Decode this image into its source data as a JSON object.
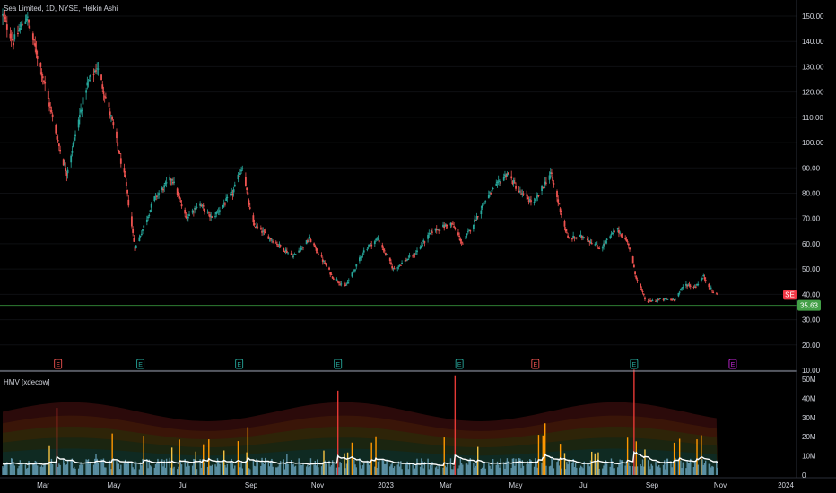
{
  "header": {
    "title": "Sea Limited, 1D, NYSE, Heikin Ashi",
    "symbol_badge": "SE",
    "price_badge": "35.63",
    "volume_indicator_label": "HMV [xdecow]"
  },
  "colors": {
    "up": "#26a69a",
    "down": "#ef5350",
    "price_line": "#2e7d32",
    "price_badge_bg": "#43a047",
    "symbol_badge_bg": "#f23645",
    "earn_past": "#ef5350",
    "earn_up": "#26a69a",
    "earn_future": "#c026d3",
    "vol_ma": "#ffffff"
  },
  "chart_data": [
    {
      "type": "candlestick",
      "title": "Sea Limited, 1D, NYSE, Heikin Ashi",
      "y_ticks": [
        "150.00",
        "140.00",
        "130.00",
        "120.00",
        "110.00",
        "100.00",
        "90.00",
        "80.00",
        "70.00",
        "60.00",
        "50.00",
        "40.00",
        "30.00",
        "20.00",
        "10.00"
      ],
      "ylim": [
        10,
        150
      ],
      "x_ticks": [
        "Mar",
        "May",
        "Jul",
        "Sep",
        "Nov",
        "2023",
        "Mar",
        "May",
        "Jul",
        "Sep",
        "Nov",
        "2024"
      ],
      "current_price": 35.63,
      "last_close": 40,
      "price_path": [
        [
          "2022-01-10",
          150
        ],
        [
          "2022-01-20",
          140
        ],
        [
          "2022-02-01",
          150
        ],
        [
          "2022-02-15",
          128
        ],
        [
          "2022-03-05",
          95
        ],
        [
          "2022-03-10",
          88
        ],
        [
          "2022-03-28",
          122
        ],
        [
          "2022-04-07",
          130
        ],
        [
          "2022-04-20",
          110
        ],
        [
          "2022-05-03",
          85
        ],
        [
          "2022-05-12",
          58
        ],
        [
          "2022-05-30",
          78
        ],
        [
          "2022-06-15",
          86
        ],
        [
          "2022-06-28",
          70
        ],
        [
          "2022-07-10",
          76
        ],
        [
          "2022-07-22",
          70
        ],
        [
          "2022-08-10",
          80
        ],
        [
          "2022-08-19",
          91
        ],
        [
          "2022-08-28",
          68
        ],
        [
          "2022-09-20",
          60
        ],
        [
          "2022-10-05",
          55
        ],
        [
          "2022-10-20",
          62
        ],
        [
          "2022-11-10",
          47
        ],
        [
          "2022-11-22",
          43
        ],
        [
          "2022-12-10",
          58
        ],
        [
          "2022-12-22",
          62
        ],
        [
          "2023-01-05",
          50
        ],
        [
          "2023-01-25",
          56
        ],
        [
          "2023-02-10",
          65
        ],
        [
          "2023-02-28",
          68
        ],
        [
          "2023-03-10",
          60
        ],
        [
          "2023-04-01",
          78
        ],
        [
          "2023-04-20",
          88
        ],
        [
          "2023-05-02",
          80
        ],
        [
          "2023-05-15",
          76
        ],
        [
          "2023-05-30",
          88
        ],
        [
          "2023-06-15",
          62
        ],
        [
          "2023-06-30",
          63
        ],
        [
          "2023-07-15",
          58
        ],
        [
          "2023-07-30",
          66
        ],
        [
          "2023-08-10",
          60
        ],
        [
          "2023-08-16",
          48
        ],
        [
          "2023-08-26",
          37
        ],
        [
          "2023-09-10",
          38
        ],
        [
          "2023-09-21",
          38
        ],
        [
          "2023-10-01",
          44
        ],
        [
          "2023-10-10",
          43
        ],
        [
          "2023-10-18",
          47
        ],
        [
          "2023-10-28",
          40
        ]
      ]
    },
    {
      "type": "bar",
      "title": "HMV [xdecow]",
      "y_ticks": [
        "50M",
        "40M",
        "30M",
        "20M",
        "10M",
        "0"
      ],
      "ylim": [
        0,
        50000000
      ],
      "spikes": [
        [
          "2022-02-12",
          40000000
        ],
        [
          "2022-03-01",
          35000000
        ],
        [
          "2022-08-24",
          25000000
        ],
        [
          "2022-11-15",
          44000000
        ],
        [
          "2023-03-03",
          52000000
        ],
        [
          "2023-05-25",
          27000000
        ],
        [
          "2023-08-15",
          55000000
        ],
        [
          "2023-09-24",
          37000000
        ]
      ]
    }
  ],
  "earnings": [
    {
      "date": "2022-03-02",
      "letter": "E",
      "kind": "past"
    },
    {
      "date": "2022-05-17",
      "letter": "E",
      "kind": "up"
    },
    {
      "date": "2022-08-16",
      "letter": "E",
      "kind": "up"
    },
    {
      "date": "2022-11-15",
      "letter": "E",
      "kind": "up"
    },
    {
      "date": "2023-03-07",
      "letter": "E",
      "kind": "up"
    },
    {
      "date": "2023-05-16",
      "letter": "E",
      "kind": "past"
    },
    {
      "date": "2023-08-15",
      "letter": "E",
      "kind": "up"
    },
    {
      "date": "2023-11-14",
      "letter": "E",
      "kind": "future"
    }
  ]
}
